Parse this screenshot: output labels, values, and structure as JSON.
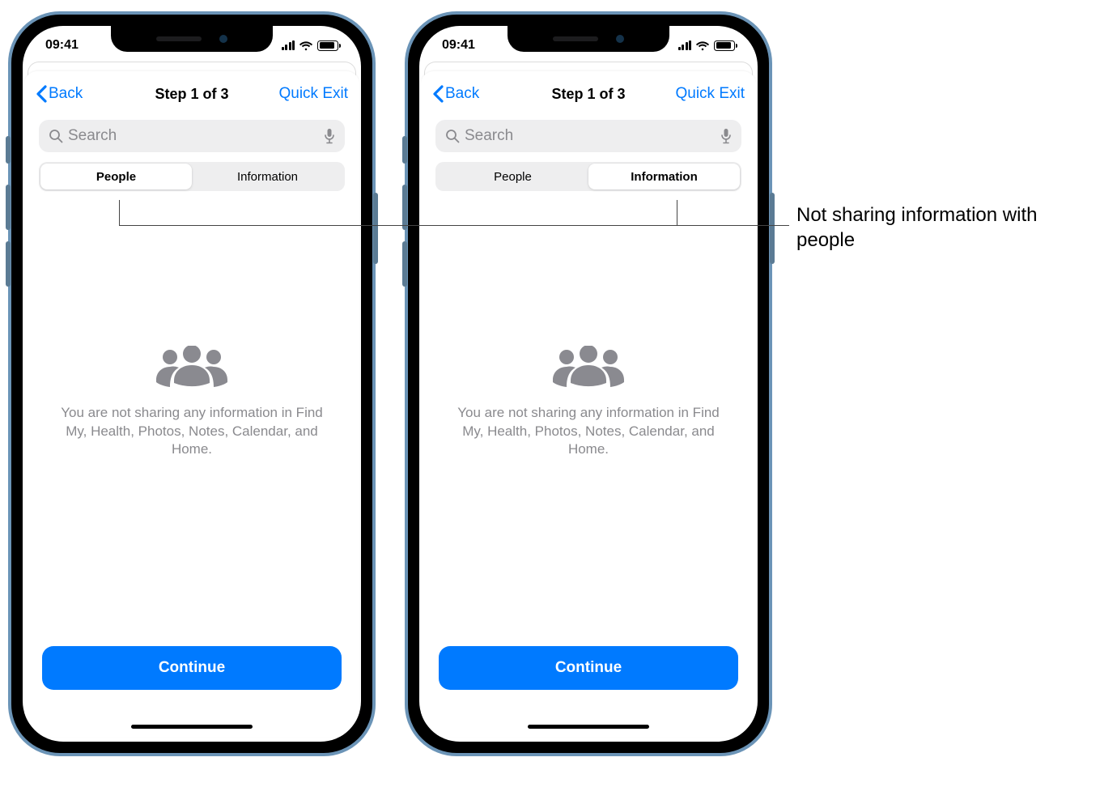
{
  "statusbar": {
    "time": "09:41"
  },
  "nav": {
    "back_label": "Back",
    "title": "Step 1 of 3",
    "quick_exit_label": "Quick Exit"
  },
  "search": {
    "placeholder": "Search"
  },
  "segments": {
    "people": "People",
    "information": "Information"
  },
  "empty": {
    "message": "You are not sharing any information in Find My, Health, Photos, Notes, Calendar, and Home."
  },
  "cta": {
    "continue_label": "Continue"
  },
  "callout": {
    "text": "Not sharing information with people"
  }
}
